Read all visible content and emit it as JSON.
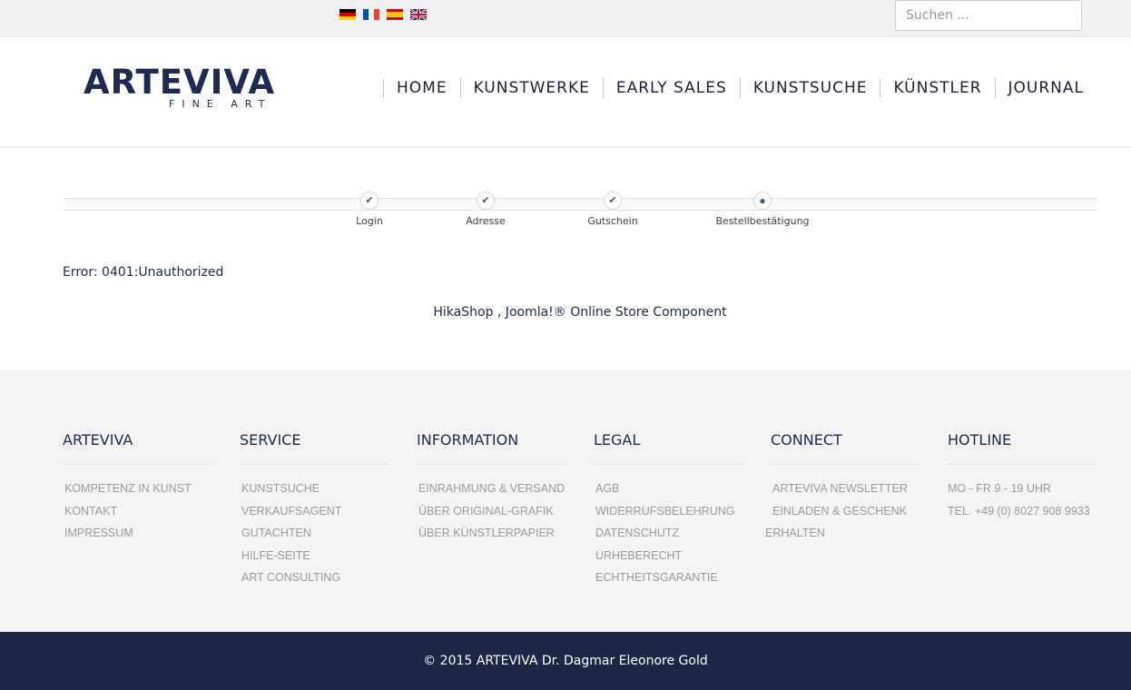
{
  "topbar": {
    "flags": [
      "flag-de-icon",
      "flag-fr-icon",
      "flag-es-icon",
      "flag-gb-icon"
    ],
    "search_placeholder": "Suchen ..."
  },
  "header": {
    "logo_main": "ARTEVIVA",
    "logo_sub": "FINE ART",
    "nav": [
      "HOME",
      "KUNSTWERKE",
      "EARLY SALES",
      "KUNSTSUCHE",
      "KÜNSTLER",
      "JOURNAL"
    ]
  },
  "checkout": {
    "steps": [
      {
        "label": "Login",
        "state": "done"
      },
      {
        "label": "Adresse",
        "state": "done"
      },
      {
        "label": "Gutschein",
        "state": "done"
      },
      {
        "label": "Bestellbestätigung",
        "state": "current"
      }
    ],
    "error": "Error: 0401:Unauthorized",
    "powered_by": "HikaShop , Joomla!® Online Store Component"
  },
  "footer": {
    "columns": [
      {
        "title": "ARTEVIVA",
        "items": [
          "KOMPETENZ IN KUNST",
          "KONTAKT",
          "IMPRESSUM"
        ]
      },
      {
        "title": "SERVICE",
        "items": [
          "KUNSTSUCHE",
          "VERKAUFSAGENT",
          "GUTACHTEN",
          "HILFE-SEITE",
          "ART CONSULTING"
        ]
      },
      {
        "title": "INFORMATION",
        "items": [
          "EINRAHMUNG & VERSAND",
          "ÜBER ORIGINAL-GRAFIK",
          "ÜBER KÜNSTLERPAPIER"
        ]
      },
      {
        "title": "LEGAL",
        "items": [
          "AGB",
          "WIDERRUFSBELEHRUNG",
          "DATENSCHUTZ",
          "URHEBERECHT",
          "ECHTHEITSGARANTIE"
        ]
      },
      {
        "title": "CONNECT",
        "items": [
          "ARTEVIVA NEWSLETTER",
          "EINLADEN & GESCHENK",
          "ERHALTEN"
        ]
      },
      {
        "title": "HOTLINE",
        "items": [
          "MO - FR 9 - 19 UHR",
          "TEL. +49 (0) 8027 908 9933"
        ]
      }
    ],
    "copyright": "© 2015 ARTEVIVA Dr. Dagmar Eleonore Gold"
  },
  "colors": {
    "brand_navy": "#1e2a52",
    "footer_bottom": "#1e2646",
    "footer_bg": "#f3f3f3",
    "topbar_bg": "#efefef",
    "step_active": "#1c6b8c"
  }
}
